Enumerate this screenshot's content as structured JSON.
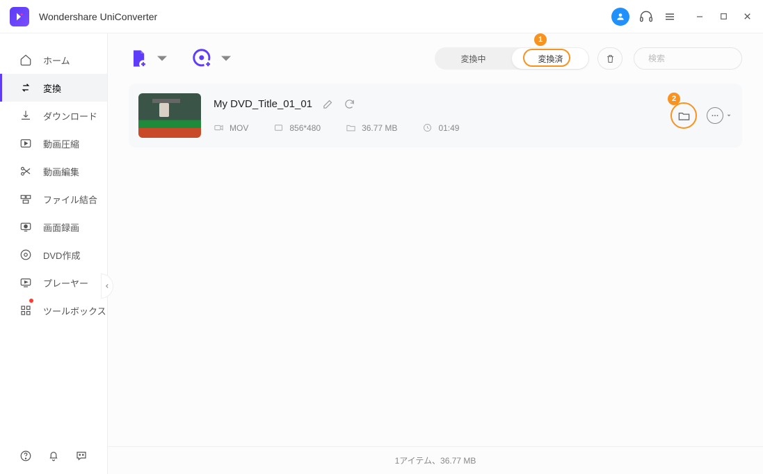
{
  "app": {
    "title": "Wondershare UniConverter"
  },
  "sidebar": {
    "items": [
      {
        "label": "ホーム"
      },
      {
        "label": "変換"
      },
      {
        "label": "ダウンロード"
      },
      {
        "label": "動画圧縮"
      },
      {
        "label": "動画編集"
      },
      {
        "label": "ファイル結合"
      },
      {
        "label": "画面録画"
      },
      {
        "label": "DVD作成"
      },
      {
        "label": "プレーヤー"
      },
      {
        "label": "ツールボックス"
      }
    ]
  },
  "tabs": {
    "converting": "変換中",
    "converted": "変換済"
  },
  "search": {
    "placeholder": "検索"
  },
  "annotations": {
    "one": "1",
    "two": "2"
  },
  "item": {
    "title": "My DVD_Title_01_01",
    "format": "MOV",
    "resolution": "856*480",
    "size": "36.77 MB",
    "duration": "01:49"
  },
  "status": {
    "text": "1アイテム、36.77 MB"
  }
}
